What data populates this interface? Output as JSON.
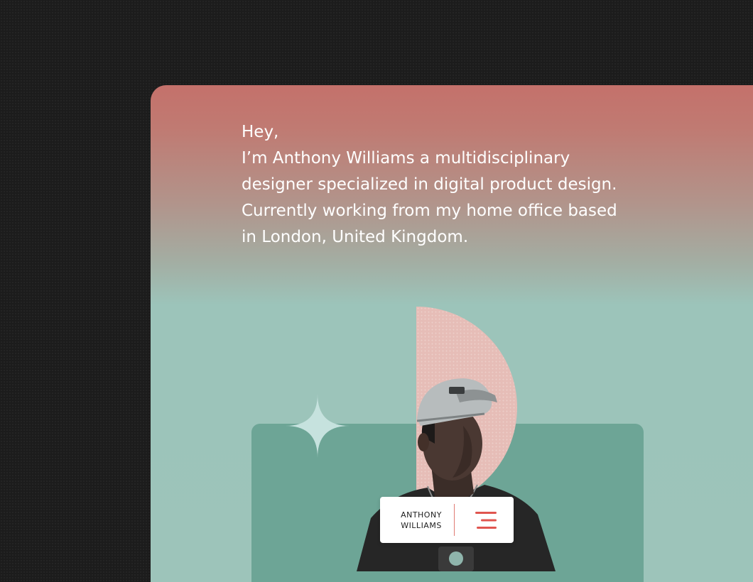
{
  "intro": {
    "greeting": "Hey,",
    "lines": [
      "I’m Anthony Williams a multidisciplinary",
      "designer specialized in digital product design.",
      "Currently working from my home office based",
      "in London, United Kingdom."
    ]
  },
  "badge": {
    "first_name": "ANTHONY",
    "last_name": "WILLIAMS",
    "icon": "menu-icon"
  },
  "colors": {
    "background": "#1c1c1c",
    "card_top": "#c4716b",
    "card_bottom": "#9cc4ba",
    "panel": "#6da596",
    "arc": "#e6bdb7",
    "accent": "#e0554f"
  }
}
